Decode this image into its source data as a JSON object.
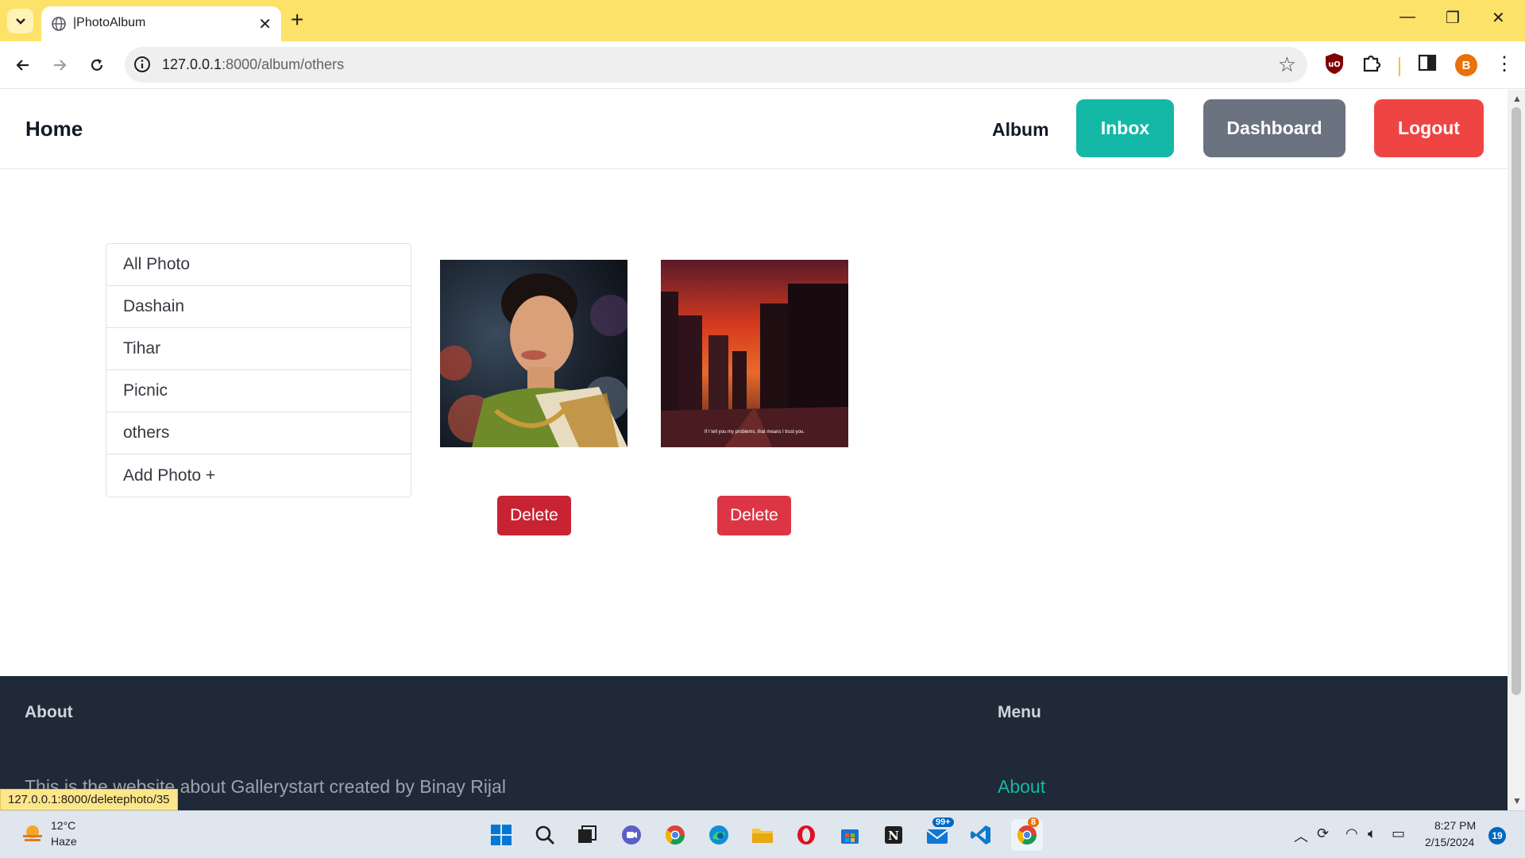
{
  "browser": {
    "tab_title": "|PhotoAlbum",
    "url_host": "127.0.0.1",
    "url_path": ":8000/album/others",
    "profile_initial": "B",
    "status_url": "127.0.0.1:8000/deletephoto/35"
  },
  "site": {
    "brand": "Home",
    "nav": {
      "album": "Album",
      "inbox": "Inbox",
      "dashboard": "Dashboard",
      "logout": "Logout"
    },
    "colors": {
      "inbox": "#14b8a6",
      "dashboard": "#6b7280",
      "logout": "#ef4444",
      "delete": "#dc3545",
      "footer": "#1f2937"
    }
  },
  "albums": [
    {
      "label": "All Photo"
    },
    {
      "label": "Dashain"
    },
    {
      "label": "Tihar"
    },
    {
      "label": "Picnic"
    },
    {
      "label": "others"
    },
    {
      "label": "Add Photo +"
    }
  ],
  "photos": [
    {
      "delete_label": "Delete"
    },
    {
      "caption": "If I tell you my problems, that means I trust you.",
      "delete_label": "Delete"
    }
  ],
  "footer": {
    "about_heading": "About",
    "about_text": "This is the website about Gallerystart created by Binay Rijal",
    "menu_heading": "Menu",
    "menu_link": "About"
  },
  "taskbar": {
    "weather_temp": "12°C",
    "weather_desc": "Haze",
    "mail_badge": "99+",
    "chrome_badge": "8",
    "time": "8:27 PM",
    "date": "2/15/2024",
    "notifications": "19"
  }
}
